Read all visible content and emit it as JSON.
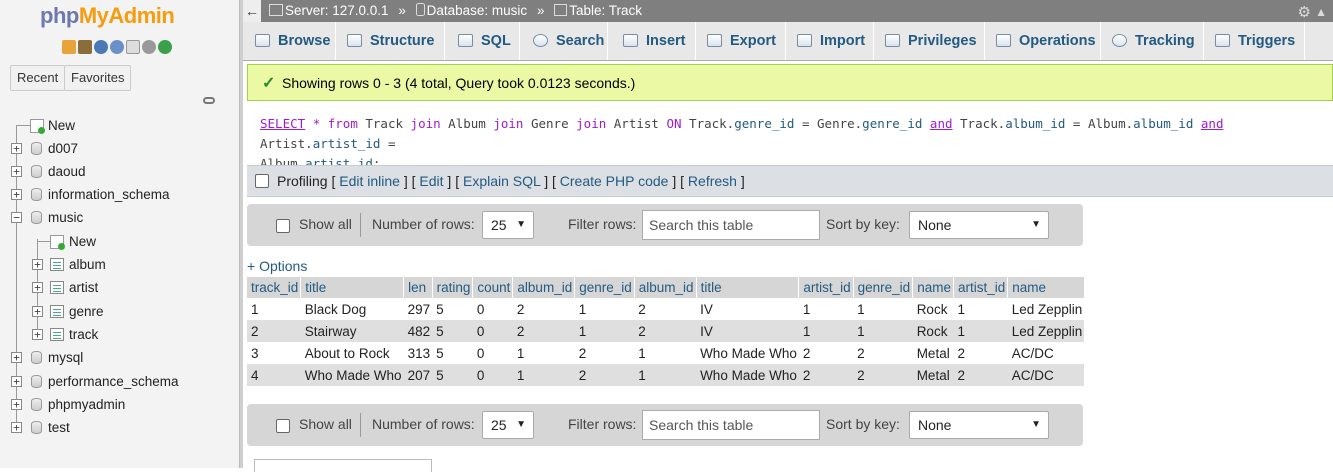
{
  "app": {
    "logo_php": "php",
    "logo_myadmin": "MyAdmin"
  },
  "nav": {
    "recent_label": "Recent",
    "favorites_label": "Favorites",
    "tree": [
      {
        "label": "New",
        "type": "new"
      },
      {
        "label": "d007",
        "type": "db"
      },
      {
        "label": "daoud",
        "type": "db"
      },
      {
        "label": "information_schema",
        "type": "db"
      },
      {
        "label": "music",
        "type": "db-open"
      },
      {
        "label": "New",
        "type": "new-child"
      },
      {
        "label": "album",
        "type": "table"
      },
      {
        "label": "artist",
        "type": "table"
      },
      {
        "label": "genre",
        "type": "table"
      },
      {
        "label": "track",
        "type": "table"
      },
      {
        "label": "mysql",
        "type": "db"
      },
      {
        "label": "performance_schema",
        "type": "db"
      },
      {
        "label": "phpmyadmin",
        "type": "db"
      },
      {
        "label": "test",
        "type": "db"
      }
    ]
  },
  "breadcrumb": {
    "server": "Server: 127.0.0.1",
    "database": "Database: music",
    "table": "Table: Track",
    "separator": "»"
  },
  "tabs": [
    "Browse",
    "Structure",
    "SQL",
    "Search",
    "Insert",
    "Export",
    "Import",
    "Privileges",
    "Operations",
    "Tracking",
    "Triggers"
  ],
  "message": "Showing rows 0 - 3 (4 total, Query took 0.0123 seconds.)",
  "sql": {
    "line1": [
      [
        "kw",
        "SELECT"
      ],
      [
        "t",
        " "
      ],
      [
        "kw2",
        "*"
      ],
      [
        "t",
        " "
      ],
      [
        "kw2",
        "from"
      ],
      [
        "t",
        " Track "
      ],
      [
        "kw2",
        "join"
      ],
      [
        "t",
        " Album "
      ],
      [
        "kw2",
        "join"
      ],
      [
        "t",
        " Genre "
      ],
      [
        "kw2",
        "join"
      ],
      [
        "t",
        " Artist "
      ],
      [
        "kw2",
        "ON"
      ],
      [
        "t",
        " Track."
      ],
      [
        "ref",
        "genre_id"
      ],
      [
        "t",
        " = Genre."
      ],
      [
        "ref",
        "genre_id"
      ],
      [
        "t",
        " "
      ],
      [
        "kw",
        "and"
      ],
      [
        "t",
        " Track."
      ],
      [
        "ref",
        "album_id"
      ],
      [
        "t",
        " = Album."
      ],
      [
        "ref",
        "album_id"
      ],
      [
        "t",
        " "
      ],
      [
        "kw",
        "and"
      ],
      [
        "t",
        " Artist."
      ],
      [
        "ref",
        "artist_id"
      ],
      [
        "t",
        " ="
      ]
    ],
    "line2": [
      [
        "t",
        "Album."
      ],
      [
        "ref",
        "artist_id"
      ],
      [
        "t",
        ";"
      ]
    ]
  },
  "profiling": {
    "label": "Profiling",
    "links": [
      "Edit inline",
      "Edit",
      "Explain SQL",
      "Create PHP code",
      "Refresh"
    ]
  },
  "controls": {
    "show_all": "Show all",
    "number_of_rows_label": "Number of rows:",
    "number_of_rows_value": "25",
    "filter_rows_label": "Filter rows:",
    "filter_placeholder": "Search this table",
    "sort_by_key_label": "Sort by key:",
    "sort_by_key_value": "None"
  },
  "options_link": "+ Options",
  "table": {
    "columns": [
      "track_id",
      "title",
      "len",
      "rating",
      "count",
      "album_id",
      "genre_id",
      "album_id",
      "title",
      "artist_id",
      "genre_id",
      "name",
      "artist_id",
      "name"
    ],
    "rows": [
      [
        "1",
        "Black Dog",
        "297",
        "5",
        "0",
        "2",
        "1",
        "2",
        "IV",
        "1",
        "1",
        "Rock",
        "1",
        "Led Zepplin"
      ],
      [
        "2",
        "Stairway",
        "482",
        "5",
        "0",
        "2",
        "1",
        "2",
        "IV",
        "1",
        "1",
        "Rock",
        "1",
        "Led Zepplin"
      ],
      [
        "3",
        "About to Rock",
        "313",
        "5",
        "0",
        "1",
        "2",
        "1",
        "Who Made Who",
        "2",
        "2",
        "Metal",
        "2",
        "AC/DC"
      ],
      [
        "4",
        "Who Made Who",
        "207",
        "5",
        "0",
        "1",
        "2",
        "1",
        "Who Made Who",
        "2",
        "2",
        "Metal",
        "2",
        "AC/DC"
      ]
    ]
  },
  "colors": {
    "link": "#235a81",
    "success_bg": "#ebf8a4",
    "success_border": "#a2d246",
    "logo_php": "#6c78af",
    "logo_myadmin": "#f89c0e"
  }
}
